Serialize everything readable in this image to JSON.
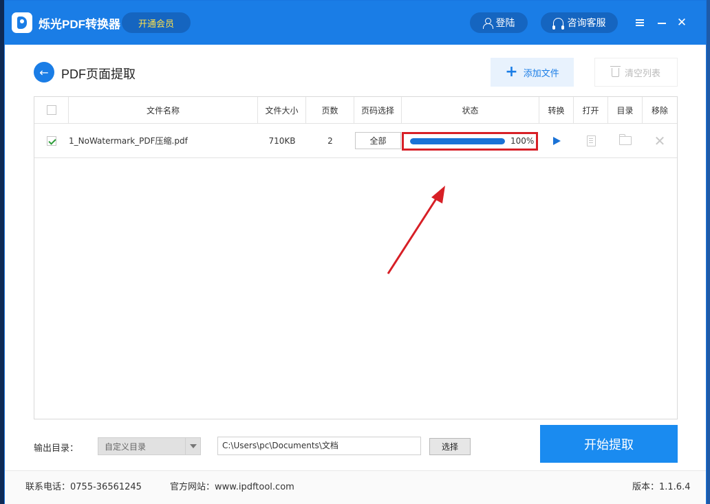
{
  "app": {
    "title": "烁光PDF转换器",
    "vip_label": "开通会员",
    "login_label": "登陆",
    "service_label": "咨询客服"
  },
  "page": {
    "title": "PDF页面提取",
    "add_file_label": "添加文件",
    "clear_list_label": "清空列表"
  },
  "table": {
    "headers": [
      "文件名称",
      "文件大小",
      "页数",
      "页码选择",
      "状态",
      "转换",
      "打开",
      "目录",
      "移除"
    ],
    "rows": [
      {
        "checked": true,
        "name": "1_NoWatermark_PDF压缩.pdf",
        "size": "710KB",
        "pages": "2",
        "range": "全部",
        "progress": 1.0,
        "progress_text": "100%"
      }
    ]
  },
  "output": {
    "label": "输出目录：",
    "select_value": "自定义目录",
    "path": "C:\\Users\\pc\\Documents\\文档",
    "choose_label": "选择",
    "start_label": "开始提取"
  },
  "footer": {
    "phone": "联系电话：0755-36561245",
    "site": "官方网站：www.ipdftool.com",
    "version": "版本：1.1.6.4"
  },
  "colors": {
    "accent": "#1a7de6",
    "highlight": "#d71f26",
    "vip_text": "#ffe14a"
  }
}
